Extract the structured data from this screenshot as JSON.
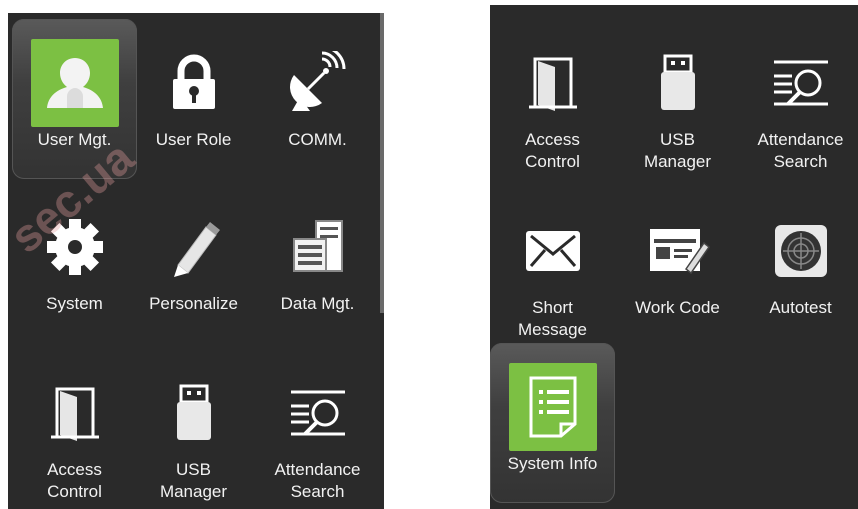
{
  "left_screen": {
    "items": [
      {
        "label": "User Mgt.",
        "icon": "user-icon",
        "selected": true
      },
      {
        "label": "User Role",
        "icon": "lock-icon",
        "selected": false
      },
      {
        "label": "COMM.",
        "icon": "satellite-dish-icon",
        "selected": false
      },
      {
        "label": "System",
        "icon": "gear-icon",
        "selected": false
      },
      {
        "label": "Personalize",
        "icon": "pencil-icon",
        "selected": false
      },
      {
        "label": "Data Mgt.",
        "icon": "data-management-icon",
        "selected": false
      },
      {
        "label": "Access\nControl",
        "icon": "door-icon",
        "selected": false
      },
      {
        "label": "USB\nManager",
        "icon": "usb-drive-icon",
        "selected": false
      },
      {
        "label": "Attendance\nSearch",
        "icon": "search-lines-icon",
        "selected": false
      }
    ]
  },
  "right_screen": {
    "items": [
      {
        "label": "Access\nControl",
        "icon": "door-icon",
        "selected": false
      },
      {
        "label": "USB\nManager",
        "icon": "usb-drive-icon",
        "selected": false
      },
      {
        "label": "Attendance\nSearch",
        "icon": "search-lines-icon",
        "selected": false
      },
      {
        "label": "Short\nMessage",
        "icon": "envelope-icon",
        "selected": false
      },
      {
        "label": "Work Code",
        "icon": "work-code-icon",
        "selected": false
      },
      {
        "label": "Autotest",
        "icon": "target-icon",
        "selected": false
      },
      {
        "label": "System Info",
        "icon": "document-icon",
        "selected": true
      }
    ]
  },
  "watermark": "sec.ua",
  "colors": {
    "screen_bg": "#2a2a2a",
    "accent_green": "#7cc043",
    "label": "#f2f2f2"
  }
}
